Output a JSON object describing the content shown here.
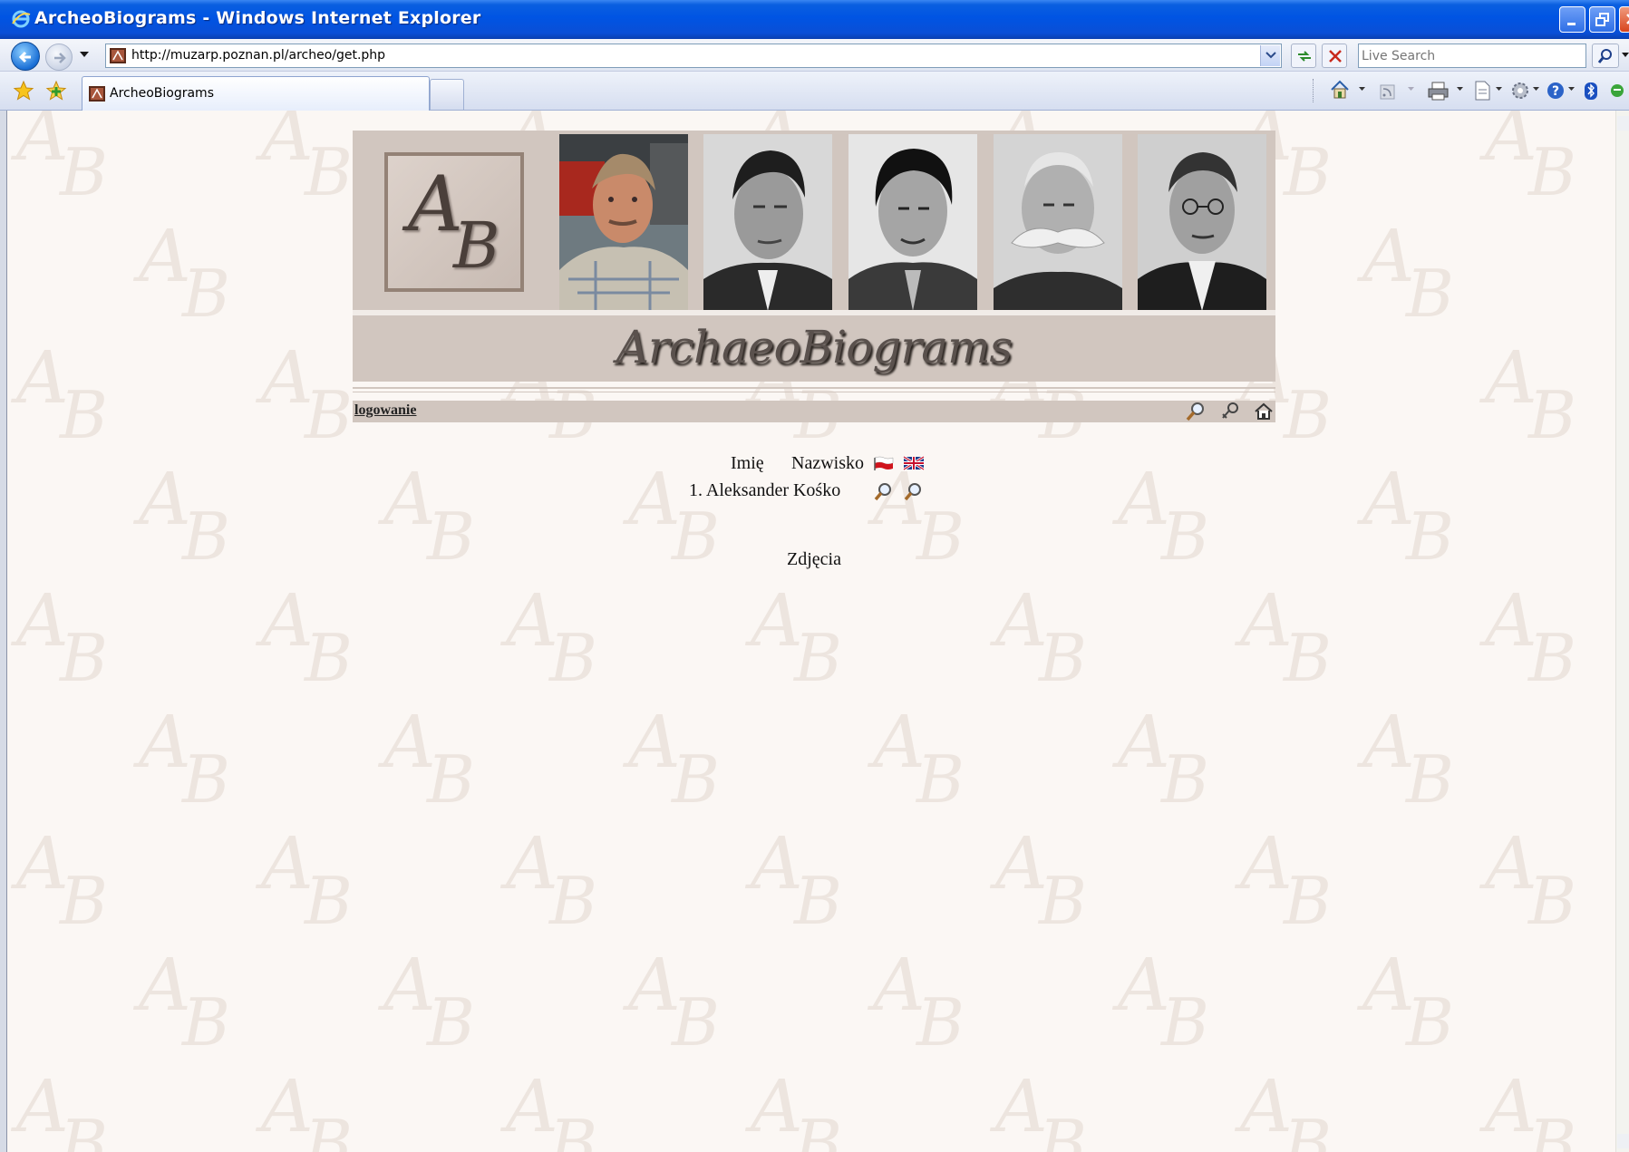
{
  "window": {
    "title": "ArcheoBiograms - Windows Internet Explorer"
  },
  "toolbar": {
    "url": "http://muzarp.poznan.pl/archeo/get.php",
    "search_placeholder": "Live Search"
  },
  "tab": {
    "label": "ArcheoBiograms"
  },
  "banner": {
    "logo_letters": [
      "A",
      "B"
    ],
    "title": "ArchaeoBiograms"
  },
  "nav": {
    "login_label": "logowanie",
    "icons": [
      "search-icon",
      "keys-icon",
      "home-icon"
    ]
  },
  "results": {
    "columns": [
      "Imię",
      "Nazwisko"
    ],
    "language_flags": [
      "polish-flag-icon",
      "english-flag-icon"
    ],
    "rows": [
      {
        "number": "1.",
        "first_name": "Aleksander",
        "last_name": "Kośko"
      }
    ]
  },
  "photos_label": "Zdjęcia",
  "colors": {
    "xp_titlebar": "#0054e3",
    "page_background": "#fbf7f4",
    "banner_background": "#d1c6bf"
  }
}
